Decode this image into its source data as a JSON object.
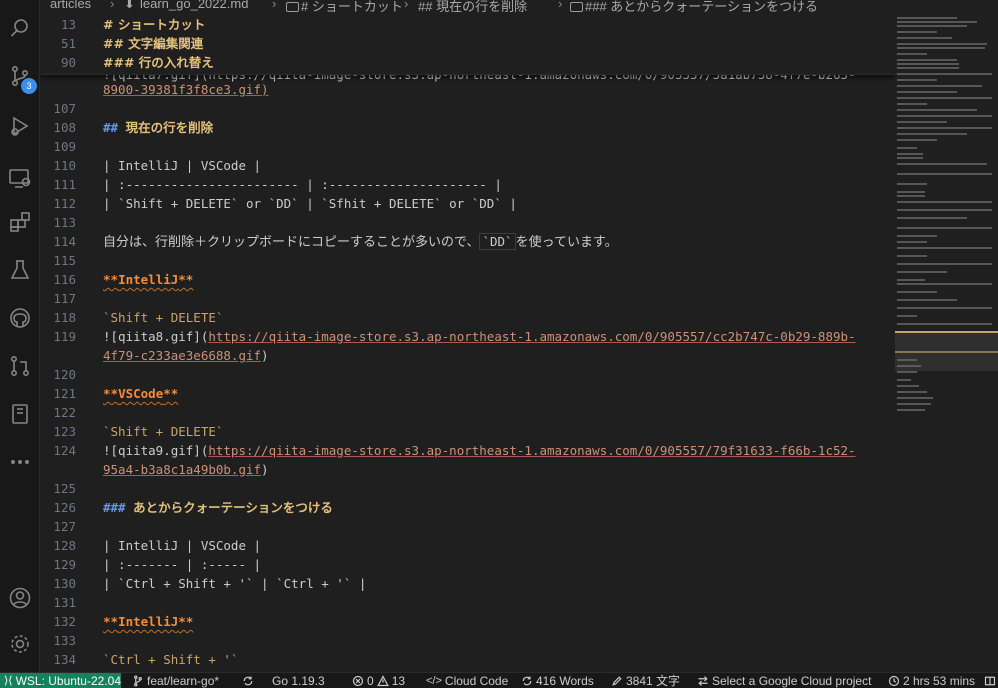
{
  "breadcrumb": {
    "items": [
      "articles",
      "learn_go_2022.md",
      "# ショートカット",
      "## 現在の行を削除",
      "### あとからクォーテーションをつける"
    ]
  },
  "activity_bar": {
    "icons": [
      "search-icon",
      "source-control-icon",
      "run-debug-icon",
      "remote-explorer-icon",
      "extensions-icon",
      "testing-icon",
      "github-icon",
      "pull-requests-icon",
      "notebook-icon",
      "more-icon",
      "account-icon",
      "settings-gear-icon"
    ],
    "scm_badge": "3"
  },
  "sticky": [
    {
      "ln": "13",
      "text": "# ショートカット"
    },
    {
      "ln": "51",
      "text": "## 文字編集関連"
    },
    {
      "ln": "90",
      "text": "### 行の入れ替え"
    }
  ],
  "editor": {
    "partial_top": "![qiita7.gif](https://qiita-image-store.s3.ap-northeast-1.amazonaws.com/0/905557/5a1ab738-4f7e-b265-",
    "partial_top_cont": "8900-39381f3f8ce3.gif)",
    "lines": {
      "l107": "107",
      "l108": "108",
      "l109": "109",
      "l110": "110",
      "l111": "111",
      "l112": "112",
      "l113": "113",
      "l114": "114",
      "l115": "115",
      "l116": "116",
      "l117": "117",
      "l118": "118",
      "l119": "119",
      "l120": "120",
      "l121": "121",
      "l122": "122",
      "l123": "123",
      "l124": "124",
      "l125": "125",
      "l126": "126",
      "l127": "127",
      "l128": "128",
      "l129": "129",
      "l130": "130",
      "l131": "131",
      "l132": "132",
      "l133": "133",
      "l134": "134"
    },
    "h2_marker": "##",
    "h2_text": "現在の行を削除",
    "t1_row1": "| IntelliJ                 | VSCode                 |",
    "t1_row2": "| :----------------------- | :--------------------- |",
    "t1_row3_a": "| `Shift + DELETE` or `DD` | `Sfhit + DELETE` or `DD` |",
    "para_a": "自分は、行削除＋クリップボードにコピーすることが多いので、",
    "para_dd": "`DD`",
    "para_b": "を使っています。",
    "bold_open": "**",
    "intellij": "IntelliJ",
    "vscode": "VSCode",
    "bold_close": "**",
    "shift_delete": "`Shift + DELETE`",
    "img8_alt": "![qiita8.gif](",
    "img8_url_a": "https://qiita-image-store.s3.ap-northeast-1.amazonaws.com/0/905557/cc2b747c-0b29-889b-",
    "img8_url_b": "4f79-c233ae3e6688.gif",
    "img9_alt": "![qiita9.gif](",
    "img9_url_a": "https://qiita-image-store.s3.ap-northeast-1.amazonaws.com/0/905557/79f31633-f66b-1c52-",
    "img9_url_b": "95a4-b3a8c1a49b0b.gif",
    "close_paren": ")",
    "h3_marker": "###",
    "h3_text": "あとからクォーテーションをつける",
    "t2_row1": "| IntelliJ | VSCode |",
    "t2_row2": "| :------- | :----- |",
    "t2_row3": "| `Ctrl + Shift + '` | `Ctrl + '` |",
    "ctrl_shift": "`Ctrl + Shift + '`"
  },
  "statusbar": {
    "remote": "WSL: Ubuntu-22.04",
    "branch": "feat/learn-go*",
    "go_version": "Go 1.19.3",
    "errors": "0",
    "warnings": "13",
    "cloud_code": "Cloud Code",
    "words": "416 Words",
    "chars": "3841 文字",
    "gcp": "Select a Google Cloud project",
    "time": "2 hrs 53 mins"
  },
  "colors": {
    "accent_remote": "#16825d",
    "heading": "#e5c07b",
    "bold": "#f58c3c",
    "url": "#ce9178"
  }
}
